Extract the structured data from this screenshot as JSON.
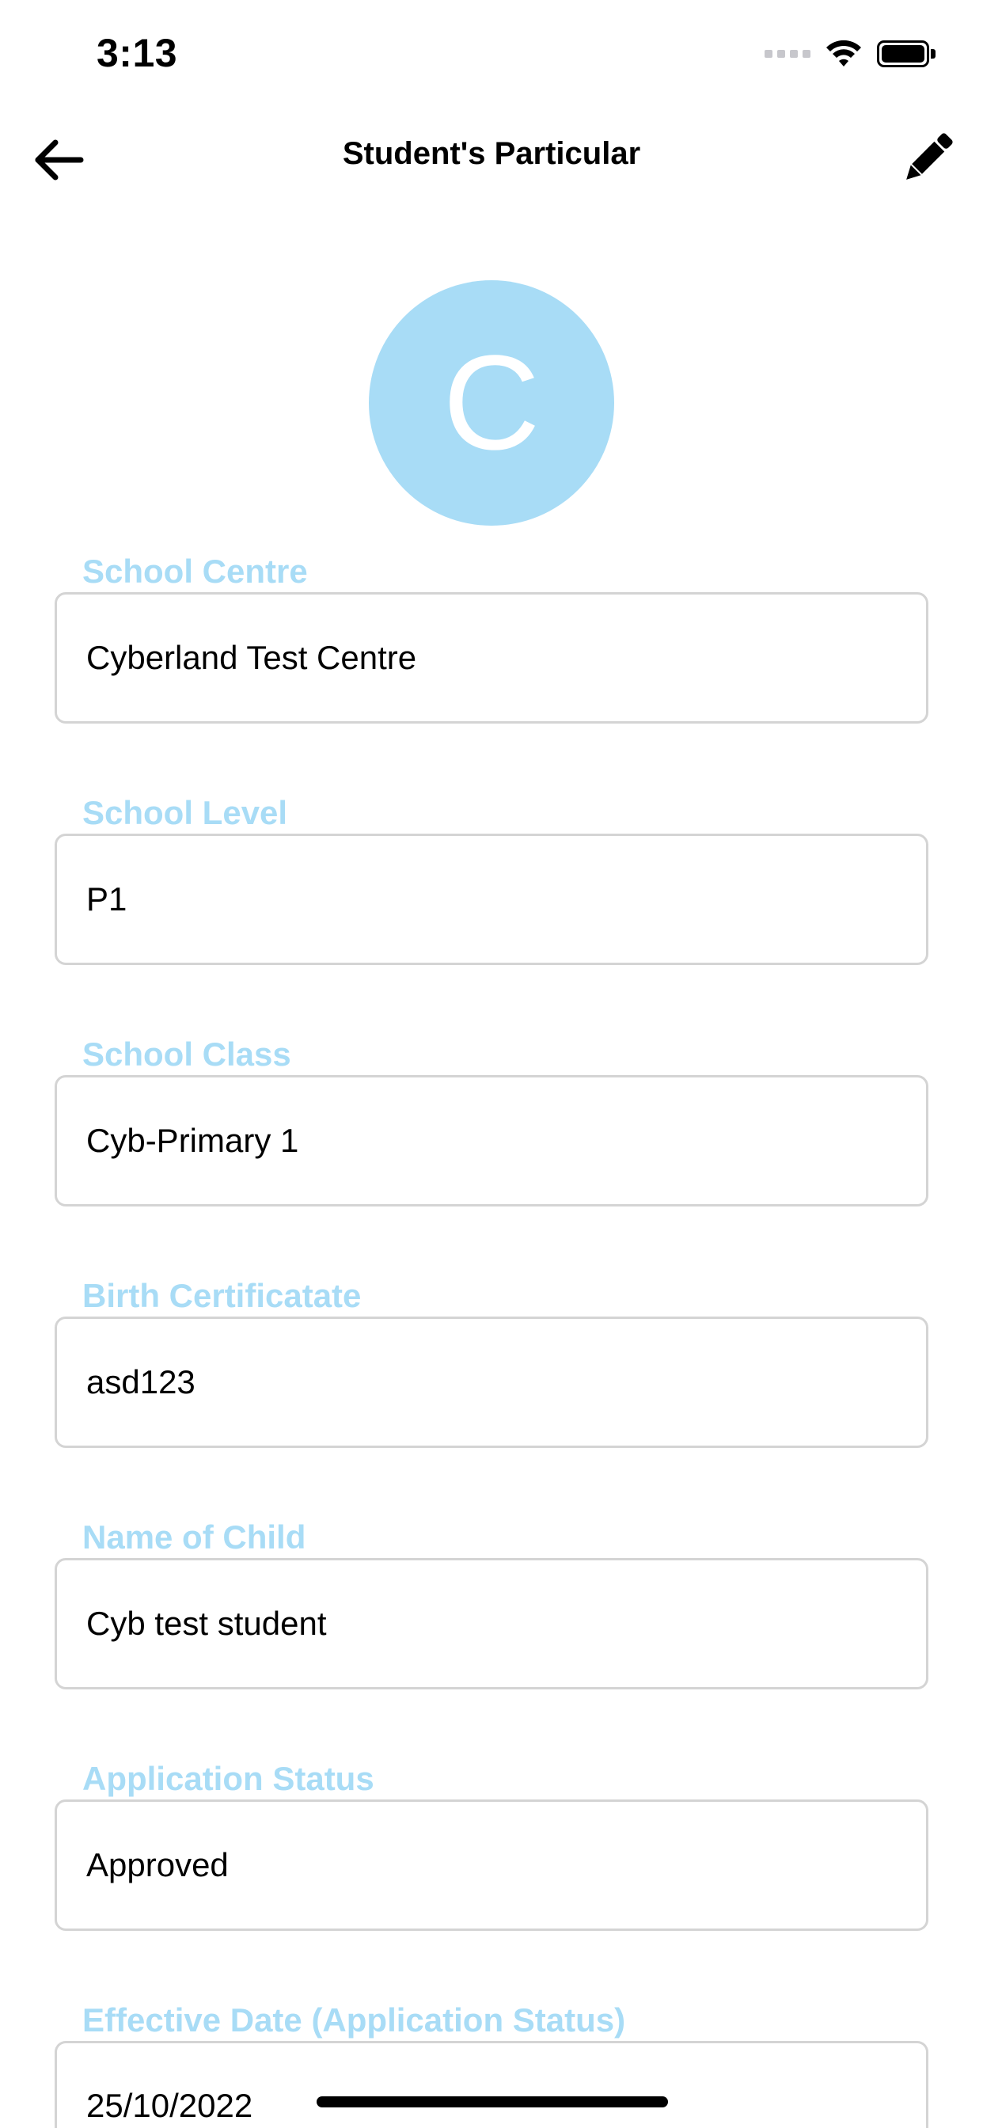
{
  "status_bar": {
    "time": "3:13",
    "icons": [
      "signal-icon",
      "wifi-icon",
      "battery-icon"
    ]
  },
  "header": {
    "title": "Student's Particular",
    "back_icon": "arrow-left-icon",
    "edit_icon": "pencil-icon"
  },
  "avatar": {
    "initial": "C",
    "color": "#a8dcf6"
  },
  "fields": [
    {
      "label": "School Centre",
      "value": "Cyberland Test Centre"
    },
    {
      "label": "School Level",
      "value": "P1"
    },
    {
      "label": "School Class",
      "value": "Cyb-Primary 1"
    },
    {
      "label": "Birth Certificatate",
      "value": "asd123"
    },
    {
      "label": "Name of Child",
      "value": "Cyb test student"
    },
    {
      "label": "Application Status",
      "value": "Approved"
    },
    {
      "label": "Effective Date (Application Status)",
      "value": "25/10/2022"
    }
  ],
  "colors": {
    "label": "#a8dcf6",
    "border": "#d4d4d4",
    "text": "#000000"
  }
}
